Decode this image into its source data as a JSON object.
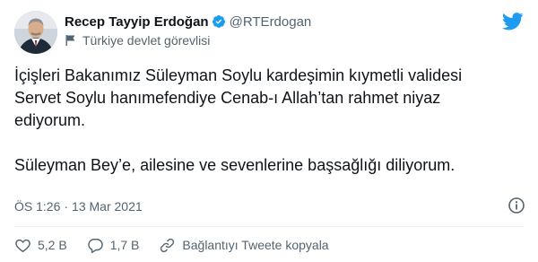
{
  "author": {
    "display_name": "Recep Tayyip Erdoğan",
    "handle": "@RTErdogan",
    "label": "Türkiye devlet görevlisi"
  },
  "tweet": {
    "lines": [
      "İçişleri Bakanımız Süleyman Soylu kardeşimin kıymetli validesi",
      "Servet Soylu hanımefendiye Cenab-ı Allah’tan rahmet niyaz",
      "ediyorum.",
      "Süleyman Bey’e, ailesine ve sevenlerine başsağlığı diliyorum."
    ],
    "time": "ÖS 1:26",
    "date": "13 Mar 2021"
  },
  "actions": {
    "likes": "5,2 B",
    "replies": "1,7 B",
    "copy_link": "Bağlantıyı Tweete kopyala"
  },
  "icons": {
    "verified": "verified-badge-icon",
    "label": "flag-icon",
    "brand": "twitter-bird-icon",
    "info": "info-icon",
    "like": "heart-icon",
    "reply": "reply-icon",
    "link": "link-icon"
  },
  "colors": {
    "accent": "#1d9bf0",
    "text": "#0f1419",
    "muted": "#536471",
    "like": "#536471"
  }
}
